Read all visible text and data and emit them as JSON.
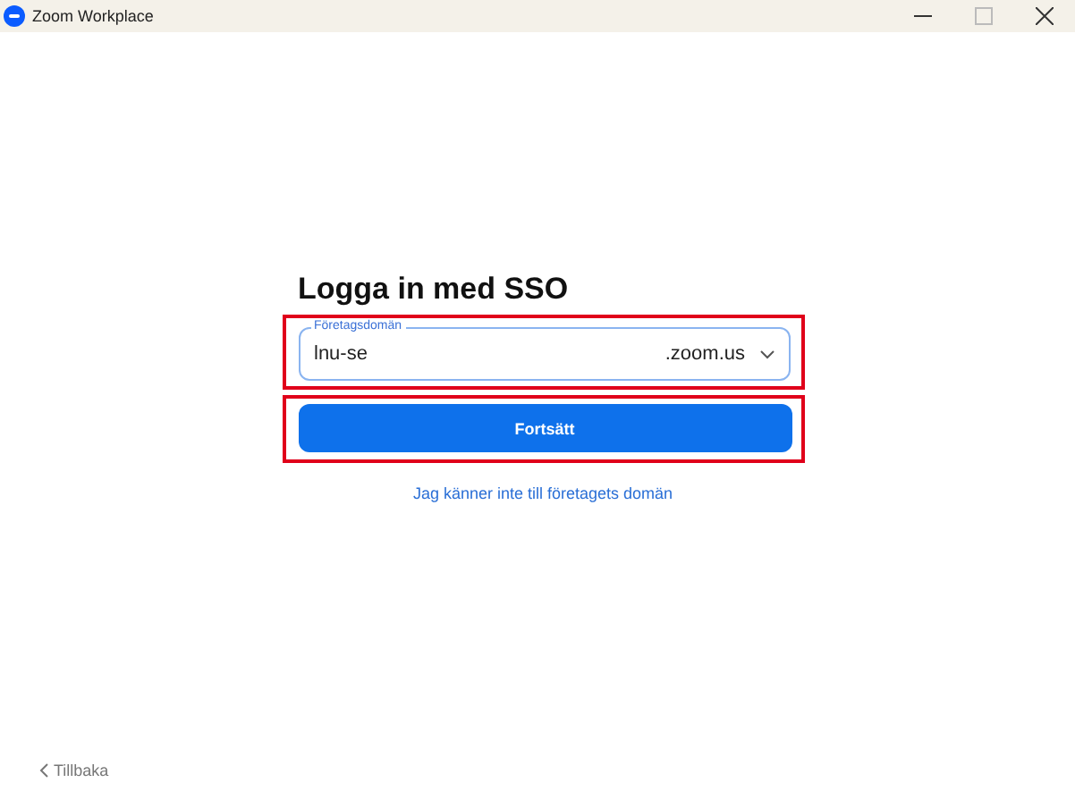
{
  "window": {
    "title": "Zoom Workplace"
  },
  "heading": "Logga in med SSO",
  "domain_field": {
    "label": "Företagsdomän",
    "value": "lnu-se",
    "suffix": ".zoom.us"
  },
  "continue_button": "Fortsätt",
  "unknown_domain_link": "Jag känner inte till företagets domän",
  "back_link": "Tillbaka"
}
